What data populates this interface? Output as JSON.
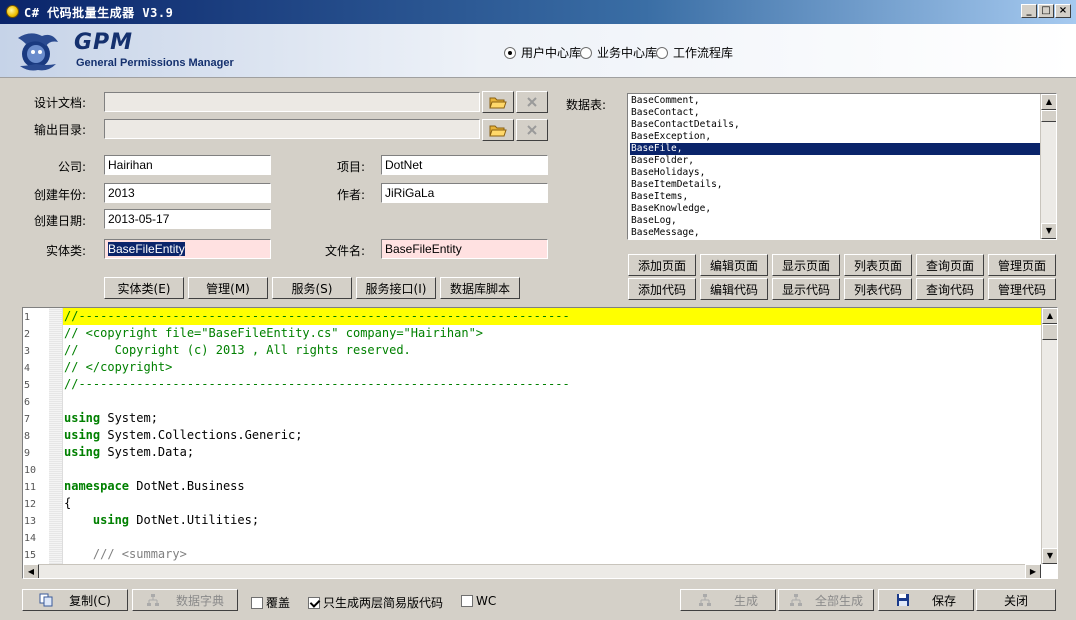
{
  "window": {
    "title": "C# 代码批量生成器 V3.9",
    "min": "_",
    "max": "□",
    "close": "×"
  },
  "banner": {
    "logo_main": "GPM",
    "logo_sub": "General Permissions Manager",
    "db_options": [
      {
        "label": "用户中心库",
        "selected": true
      },
      {
        "label": "业务中心库",
        "selected": false
      },
      {
        "label": "工作流程库",
        "selected": false
      }
    ]
  },
  "form": {
    "design_doc_label": "设计文档:",
    "design_doc_value": "",
    "output_dir_label": "输出目录:",
    "output_dir_value": "",
    "company_label": "公司:",
    "company_value": "Hairihan",
    "project_label": "项目:",
    "project_value": "DotNet",
    "year_label": "创建年份:",
    "year_value": "2013",
    "author_label": "作者:",
    "author_value": "JiRiGaLa",
    "date_label": "创建日期:",
    "date_value": "2013-05-17",
    "entity_label": "实体类:",
    "entity_value": "BaseFileEntity",
    "filename_label": "文件名:",
    "filename_value": "BaseFileEntity"
  },
  "gen_buttons": [
    "实体类(E)",
    "管理(M)",
    "服务(S)",
    "服务接口(I)",
    "数据库脚本"
  ],
  "tables": {
    "label": "数据表:",
    "items": [
      "BaseComment,",
      "BaseContact,",
      "BaseContactDetails,",
      "BaseException,",
      "BaseFile,",
      "BaseFolder,",
      "BaseHolidays,",
      "BaseItemDetails,",
      "BaseItems,",
      "BaseKnowledge,",
      "BaseLog,",
      "BaseMessage,"
    ],
    "selected_index": 4
  },
  "page_buttons": [
    "添加页面",
    "编辑页面",
    "显示页面",
    "列表页面",
    "查询页面",
    "管理页面"
  ],
  "code_buttons": [
    "添加代码",
    "编辑代码",
    "显示代码",
    "列表代码",
    "查询代码",
    "管理代码"
  ],
  "editor": {
    "line_numbers": [
      "1",
      "2",
      "3",
      "4",
      "5",
      "6",
      "7",
      "8",
      "9",
      "10",
      "11",
      "12",
      "13",
      "14",
      "15"
    ],
    "lines": [
      "//--------------------------------------------------------------------",
      "// <copyright file=\"BaseFileEntity.cs\" company=\"Hairihan\">",
      "//     Copyright (c) 2013 , All rights reserved.",
      "// </copyright>",
      "//--------------------------------------------------------------------",
      "",
      "using System;",
      "using System.Collections.Generic;",
      "using System.Data;",
      "",
      "namespace DotNet.Business",
      "{",
      "    using DotNet.Utilities;",
      "",
      "    /// <summary>"
    ]
  },
  "bottom": {
    "copy": "复制(C)",
    "dictionary": "数据字典",
    "overwrite_label": "覆盖",
    "overwrite_checked": false,
    "two_tier_label": "只生成两层简易版代码",
    "two_tier_checked": true,
    "wc_label": "WC",
    "wc_checked": false,
    "generate": "生成",
    "generate_all": "全部生成",
    "save": "保存",
    "close": "关闭"
  },
  "colors": {
    "highlight_line": "#ffff00",
    "comment": "#008000",
    "selection": "#0a246a"
  }
}
